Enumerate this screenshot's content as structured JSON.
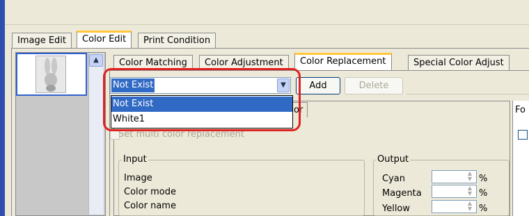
{
  "tabs": [
    "Image Edit",
    "Color Edit",
    "Print Condition"
  ],
  "subtabs": [
    "Color Matching",
    "Color Adjustment",
    "Color Replacement",
    "Special Color Adjust"
  ],
  "combo": {
    "value": "Not Exist",
    "arrow": "▼"
  },
  "buttons": {
    "add": "Add",
    "delete": "Delete"
  },
  "dropdown": {
    "options": [
      "Not Exist",
      "White1"
    ]
  },
  "inner": {
    "tab_fragment": "or",
    "multi_label": "Set multi color replacement",
    "right_fragment": "Fo"
  },
  "input_group": {
    "title": "Input",
    "rows": [
      "Image",
      "Color mode",
      "Color name"
    ]
  },
  "output_group": {
    "title": "Output",
    "rows": [
      {
        "label": "Cyan",
        "unit": "%"
      },
      {
        "label": "Magenta",
        "unit": "%"
      },
      {
        "label": "Yellow",
        "unit": "%"
      }
    ]
  },
  "scroll_up": "▲",
  "colors": {
    "accent_tab": "#ffc83c",
    "selection": "#316ac5",
    "highlight": "#e02020"
  }
}
